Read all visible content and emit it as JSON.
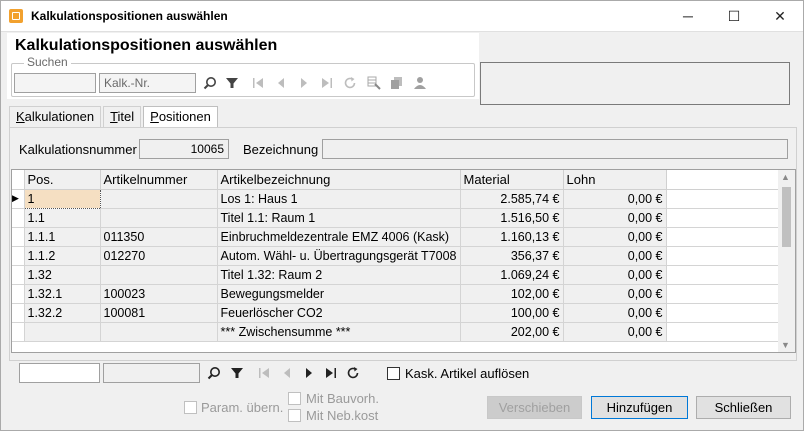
{
  "window": {
    "title": "Kalkulationspositionen auswählen",
    "minimize": "─",
    "maximize": "☐",
    "close": "✕"
  },
  "header": {
    "title": "Kalkulationspositionen auswählen",
    "search_legend": "Suchen",
    "search_field_value": "",
    "kalk_nr_placeholder": "Kalk.-Nr."
  },
  "tabs": [
    {
      "label": "Kalkulationen",
      "underline": "K",
      "rest": "alkulationen"
    },
    {
      "label": "Titel",
      "underline": "T",
      "rest": "itel"
    },
    {
      "label": "Positionen",
      "underline": "P",
      "rest": "ositionen"
    }
  ],
  "form": {
    "kalk_nr_label": "Kalkulationsnummer",
    "kalk_nr_value": "10065",
    "bezeichnung_label": "Bezeichnung",
    "bezeichnung_value": ""
  },
  "table": {
    "columns": [
      "Pos.",
      "Artikelnummer",
      "Artikelbezeichnung",
      "Material",
      "Lohn"
    ],
    "rows": [
      {
        "pos": "1",
        "artnr": "",
        "bez": "Los 1: Haus 1",
        "material": "2.585,74 €",
        "lohn": "0,00 €"
      },
      {
        "pos": "1.1",
        "artnr": "",
        "bez": "Titel 1.1: Raum 1",
        "material": "1.516,50 €",
        "lohn": "0,00 €"
      },
      {
        "pos": "1.1.1",
        "artnr": "011350",
        "bez": "Einbruchmeldezentrale EMZ 4006 (Kask)",
        "material": "1.160,13 €",
        "lohn": "0,00 €"
      },
      {
        "pos": "1.1.2",
        "artnr": "012270",
        "bez": "Autom. Wähl- u. Übertragungsgerät T7008",
        "material": "356,37 €",
        "lohn": "0,00 €"
      },
      {
        "pos": "1.32",
        "artnr": "",
        "bez": "Titel 1.32: Raum 2",
        "material": "1.069,24 €",
        "lohn": "0,00 €"
      },
      {
        "pos": "1.32.1",
        "artnr": "100023",
        "bez": "Bewegungsmelder",
        "material": "102,00 €",
        "lohn": "0,00 €"
      },
      {
        "pos": "1.32.2",
        "artnr": "100081",
        "bez": "Feuerlöscher CO2",
        "material": "100,00 €",
        "lohn": "0,00 €"
      },
      {
        "pos": "",
        "artnr": "",
        "bez": "*** Zwischensumme ***",
        "material": "202,00 €",
        "lohn": "0,00 €"
      }
    ]
  },
  "bottom": {
    "kask_label": "Kask. Artikel auflösen",
    "param_label": "Param. übern.",
    "bauvorh_label": "Mit Bauvorh.",
    "nebkost_label": "Mit Neb.kost"
  },
  "buttons": {
    "verschieben": "Verschieben",
    "hinzufuegen": "Hinzufügen",
    "schliessen": "Schließen"
  }
}
